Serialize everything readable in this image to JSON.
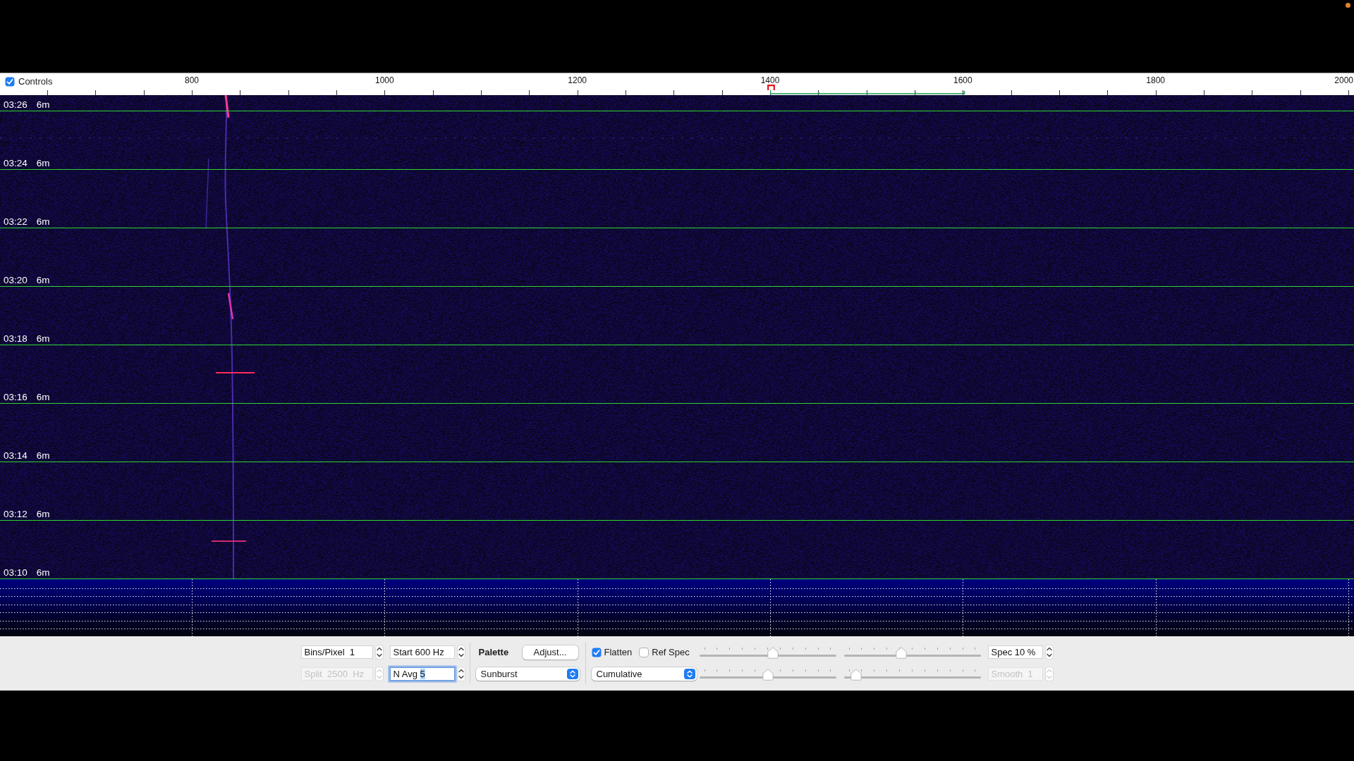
{
  "ruler": {
    "controls": {
      "label": "Controls",
      "checked": true
    },
    "ticks": [
      "800",
      "1000",
      "1200",
      "1400",
      "1600",
      "1800",
      "2000"
    ]
  },
  "waterfall": {
    "rows": [
      {
        "time": "03:26",
        "span": "6m"
      },
      {
        "time": "03:24",
        "span": "6m"
      },
      {
        "time": "03:22",
        "span": "6m"
      },
      {
        "time": "03:20",
        "span": "6m"
      },
      {
        "time": "03:18",
        "span": "6m"
      },
      {
        "time": "03:16",
        "span": "6m"
      },
      {
        "time": "03:14",
        "span": "6m"
      },
      {
        "time": "03:12",
        "span": "6m"
      },
      {
        "time": "03:10",
        "span": "6m"
      }
    ]
  },
  "controls": {
    "fields": [
      {
        "value": "Bins/Pixel  1",
        "disabled": false,
        "focused": false
      },
      {
        "value": "Start 600 Hz",
        "disabled": false,
        "focused": false
      },
      {
        "value": "Split  2500  Hz",
        "disabled": true,
        "focused": false
      },
      {
        "value": "N Avg",
        "selected_text": "5",
        "disabled": false,
        "focused": true
      }
    ],
    "palette": {
      "label": "Palette",
      "button": "Adjust...",
      "popup": "Sunburst"
    },
    "checkboxes": [
      {
        "label": "Flatten",
        "checked": true
      },
      {
        "label": "Ref Spec",
        "checked": false
      }
    ],
    "mode_popup": "Cumulative",
    "sliders": [
      {
        "level": 0.54
      },
      {
        "level": 0.42
      },
      {
        "level": 0.5
      },
      {
        "level": 0.09
      }
    ],
    "side_fields": [
      {
        "value": "Spec 10 %",
        "disabled": false
      },
      {
        "value": "Smooth  1",
        "disabled": true
      }
    ]
  }
}
